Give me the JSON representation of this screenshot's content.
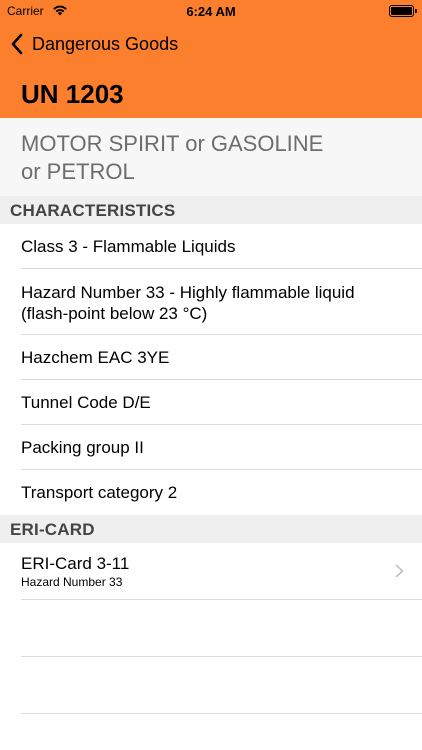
{
  "status_bar": {
    "carrier": "Carrier",
    "time": "6:24 AM"
  },
  "nav": {
    "back_label": "Dangerous Goods"
  },
  "header": {
    "un_number": "UN 1203",
    "color": "#fb7f2d"
  },
  "substance": {
    "name_line1": "MOTOR SPIRIT or GASOLINE",
    "name_line2": "or PETROL"
  },
  "characteristics": {
    "header": "CHARACTERISTICS",
    "items": [
      {
        "line1": "Class 3 - Flammable Liquids"
      },
      {
        "line1": "Hazard Number 33 - Highly flammable liquid",
        "line2": "(flash-point below 23 °C)"
      },
      {
        "line1": "Hazchem EAC 3YE"
      },
      {
        "line1": "Tunnel Code D/E"
      },
      {
        "line1": "Packing group II"
      },
      {
        "line1": "Transport category 2"
      }
    ]
  },
  "eri": {
    "header": "ERI-CARD",
    "items": [
      {
        "title": "ERI-Card 3-11",
        "subtitle": "Hazard Number 33"
      }
    ]
  }
}
